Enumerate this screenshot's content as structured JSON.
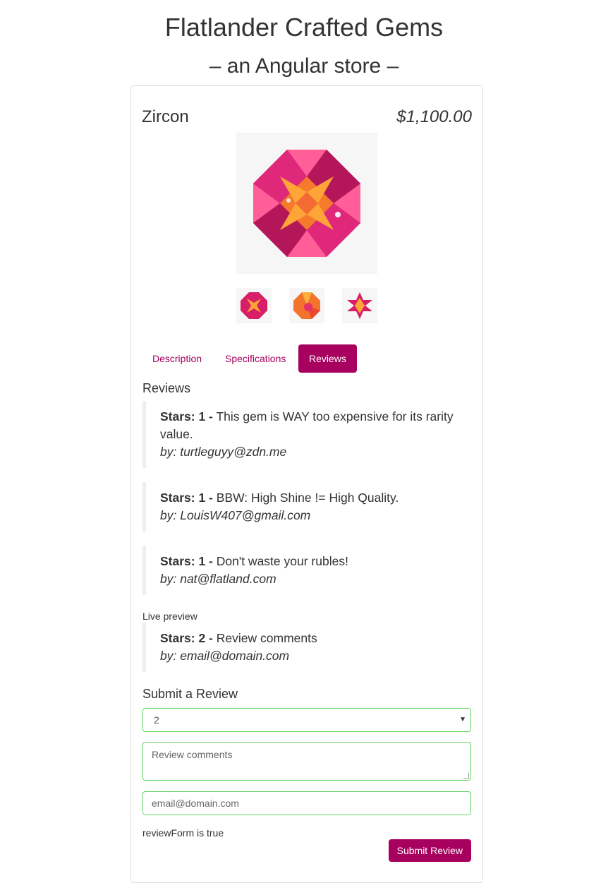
{
  "header": {
    "title": "Flatlander Crafted Gems",
    "subtitle": "– an Angular store –"
  },
  "product": {
    "name": "Zircon",
    "price": "$1,100.00",
    "colors": {
      "accent": "#a7005e",
      "valid_border": "#66d466"
    }
  },
  "tabs": [
    {
      "label": "Description",
      "active": false
    },
    {
      "label": "Specifications",
      "active": false
    },
    {
      "label": "Reviews",
      "active": true
    }
  ],
  "reviews_section": {
    "heading": "Reviews",
    "items": [
      {
        "stars": "Stars: 1 -",
        "body": "This gem is WAY too expensive for its rarity value.",
        "author": "by: turtleguyy@zdn.me"
      },
      {
        "stars": "Stars: 1 -",
        "body": "BBW: High Shine != High Quality.",
        "author": "by: LouisW407@gmail.com"
      },
      {
        "stars": "Stars: 1 -",
        "body": "Don't waste your rubles!",
        "author": "by: nat@flatland.com"
      }
    ]
  },
  "preview": {
    "label": "Live preview",
    "stars": "Stars: 2 -",
    "body": "Review comments",
    "author": "by: email@domain.com"
  },
  "form": {
    "heading": "Submit a Review",
    "stars_selected": "2",
    "comments_placeholder": "Review comments",
    "email_placeholder": "email@domain.com",
    "status": "reviewForm is true",
    "submit_label": "Submit Review"
  }
}
